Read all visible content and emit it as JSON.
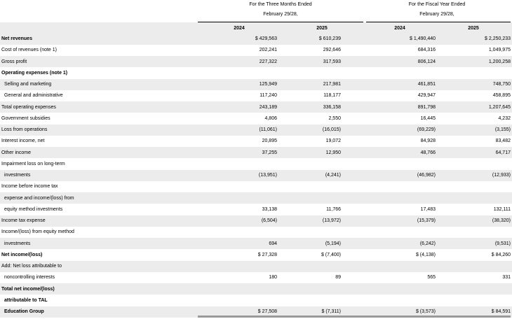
{
  "header": {
    "group1_line1": "For the Three Months Ended",
    "group1_line2": "February 29/28,",
    "group2_line1": "For the Fiscal Year Ended",
    "group2_line2": "February 29/28,",
    "years": [
      "2024",
      "2025",
      "2024",
      "2025"
    ]
  },
  "rows": [
    {
      "label": "Net revenues",
      "bold": true,
      "indent": false,
      "values": [
        "$ 429,563",
        "$ 610,239",
        "$ 1,490,440",
        "$ 2,250,233"
      ]
    },
    {
      "label": "Cost of revenues (note 1)",
      "bold": false,
      "indent": false,
      "values": [
        "202,241",
        "292,646",
        "684,316",
        "1,049,975"
      ]
    },
    {
      "label": "Gross profit",
      "bold": false,
      "indent": false,
      "values": [
        "227,322",
        "317,593",
        "806,124",
        "1,200,258"
      ]
    },
    {
      "label": "Operating expenses (note 1)",
      "bold": true,
      "indent": false,
      "values": [
        "",
        "",
        "",
        ""
      ]
    },
    {
      "label": "Selling and marketing",
      "bold": false,
      "indent": true,
      "values": [
        "125,949",
        "217,981",
        "461,851",
        "748,750"
      ]
    },
    {
      "label": "General and administrative",
      "bold": false,
      "indent": true,
      "values": [
        "117,240",
        "118,177",
        "429,947",
        "458,895"
      ]
    },
    {
      "label": "Total operating expenses",
      "bold": false,
      "indent": false,
      "values": [
        "243,189",
        "336,158",
        "891,798",
        "1,207,645"
      ]
    },
    {
      "label": "Government subsidies",
      "bold": false,
      "indent": false,
      "values": [
        "4,806",
        "2,550",
        "16,445",
        "4,232"
      ]
    },
    {
      "label": "Loss from operations",
      "bold": false,
      "indent": false,
      "values": [
        "(11,061)",
        "(16,015)",
        "(69,229)",
        "(3,155)"
      ]
    },
    {
      "label": "Interest income, net",
      "bold": false,
      "indent": false,
      "values": [
        "20,895",
        "19,072",
        "84,928",
        "83,482"
      ]
    },
    {
      "label": "Other income",
      "bold": false,
      "indent": false,
      "values": [
        "37,255",
        "12,950",
        "48,766",
        "64,717"
      ]
    },
    {
      "label": "Impairment loss on long-term",
      "bold": false,
      "indent": false,
      "values": [
        "",
        "",
        "",
        ""
      ]
    },
    {
      "label": "investments",
      "bold": false,
      "indent": true,
      "values": [
        "(13,951)",
        "(4,241)",
        "(46,982)",
        "(12,933)"
      ]
    },
    {
      "label": "Income before income tax",
      "bold": false,
      "indent": false,
      "values": [
        "",
        "",
        "",
        ""
      ]
    },
    {
      "label": "expense and income/(loss) from",
      "bold": false,
      "indent": true,
      "values": [
        "",
        "",
        "",
        ""
      ]
    },
    {
      "label": "equity method investments",
      "bold": false,
      "indent": true,
      "values": [
        "33,138",
        "11,766",
        "17,483",
        "132,111"
      ]
    },
    {
      "label": "Income tax expense",
      "bold": false,
      "indent": false,
      "values": [
        "(6,504)",
        "(13,972)",
        "(15,379)",
        "(38,320)"
      ]
    },
    {
      "label": "Income/(loss) from equity method",
      "bold": false,
      "indent": false,
      "values": [
        "",
        "",
        "",
        ""
      ]
    },
    {
      "label": "investments",
      "bold": false,
      "indent": true,
      "values": [
        "694",
        "(5,194)",
        "(6,242)",
        "(9,531)"
      ]
    },
    {
      "label": "Net income/(loss)",
      "bold": true,
      "indent": false,
      "values": [
        "$ 27,328",
        "$ (7,400)",
        "$ (4,138)",
        "$ 84,260"
      ]
    },
    {
      "label": "Add: Net loss attributable to",
      "bold": false,
      "indent": false,
      "values": [
        "",
        "",
        "",
        ""
      ]
    },
    {
      "label": "noncontrolling interests",
      "bold": false,
      "indent": true,
      "values": [
        "180",
        "89",
        "565",
        "331"
      ]
    },
    {
      "label": "Total net income/(loss)",
      "bold": true,
      "indent": false,
      "values": [
        "",
        "",
        "",
        ""
      ]
    },
    {
      "label": "attributable to TAL",
      "bold": true,
      "indent": true,
      "values": [
        "",
        "",
        "",
        ""
      ]
    },
    {
      "label": "Education Group",
      "bold": true,
      "indent": true,
      "values": [
        "$ 27,508",
        "$ (7,311)",
        "$ (3,573)",
        "$ 84,591"
      ]
    }
  ]
}
